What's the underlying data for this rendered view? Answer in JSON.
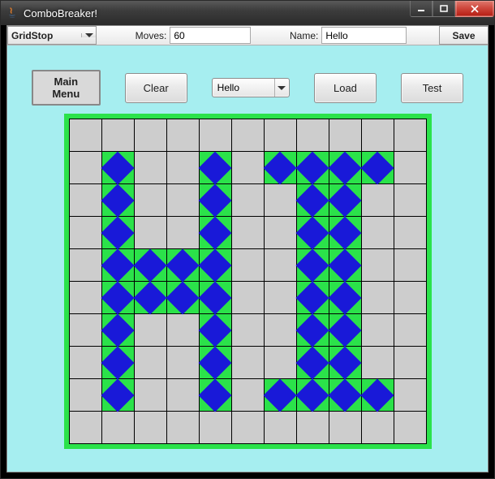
{
  "window": {
    "title": "ComboBreaker!"
  },
  "toolbar": {
    "gridstop_label": "GridStop",
    "moves_label": "Moves:",
    "moves_value": "60",
    "name_label": "Name:",
    "name_value": "Hello",
    "save_label": "Save"
  },
  "actions": {
    "main_menu": "Main Menu",
    "clear": "Clear",
    "select_value": "Hello",
    "load": "Load",
    "test": "Test"
  },
  "grid": {
    "rows": 10,
    "cols": 11,
    "filled": [
      [
        1,
        1
      ],
      [
        1,
        4
      ],
      [
        1,
        6
      ],
      [
        1,
        7
      ],
      [
        1,
        8
      ],
      [
        1,
        9
      ],
      [
        2,
        1
      ],
      [
        2,
        4
      ],
      [
        2,
        7
      ],
      [
        2,
        8
      ],
      [
        3,
        1
      ],
      [
        3,
        4
      ],
      [
        3,
        7
      ],
      [
        3,
        8
      ],
      [
        4,
        1
      ],
      [
        4,
        2
      ],
      [
        4,
        3
      ],
      [
        4,
        4
      ],
      [
        4,
        7
      ],
      [
        4,
        8
      ],
      [
        5,
        1
      ],
      [
        5,
        2
      ],
      [
        5,
        3
      ],
      [
        5,
        4
      ],
      [
        5,
        7
      ],
      [
        5,
        8
      ],
      [
        6,
        1
      ],
      [
        6,
        4
      ],
      [
        6,
        7
      ],
      [
        6,
        8
      ],
      [
        7,
        1
      ],
      [
        7,
        4
      ],
      [
        7,
        7
      ],
      [
        7,
        8
      ],
      [
        8,
        1
      ],
      [
        8,
        4
      ],
      [
        8,
        6
      ],
      [
        8,
        7
      ],
      [
        8,
        8
      ],
      [
        8,
        9
      ]
    ]
  }
}
